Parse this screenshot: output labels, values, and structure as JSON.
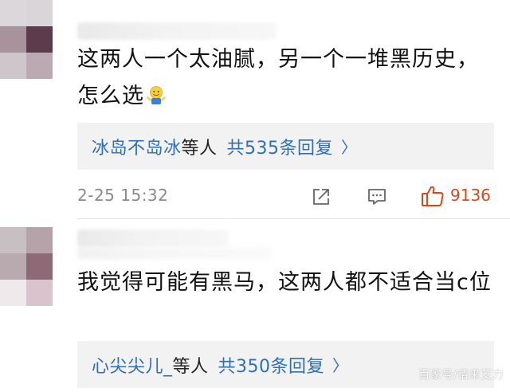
{
  "colors": {
    "link_blue": "#2e6fb5",
    "like_orange": "#d4491e",
    "meta_gray": "#8a8a8a",
    "reply_bg": "#f2f2f3"
  },
  "comments": [
    {
      "text": "这两人一个太油腻，另一个一堆黑历史，怎么选",
      "emoji": "shrug-emoji",
      "reply_user": "冰岛不岛冰",
      "reply_suffix": "等人",
      "reply_count": "共535条回复",
      "reply_arrow": "〉",
      "timestamp": "2-25 15:32",
      "actions": [
        "share-icon",
        "comment-icon",
        "like-icon"
      ],
      "likes": "9136"
    },
    {
      "text": "我觉得可能有黑马，这两人都不适合当c位",
      "reply_user": "心尖尖儿_",
      "reply_suffix": "等人",
      "reply_count": "共350条回复",
      "reply_arrow": "〉"
    }
  ],
  "watermark": "百家号/请来艾力"
}
